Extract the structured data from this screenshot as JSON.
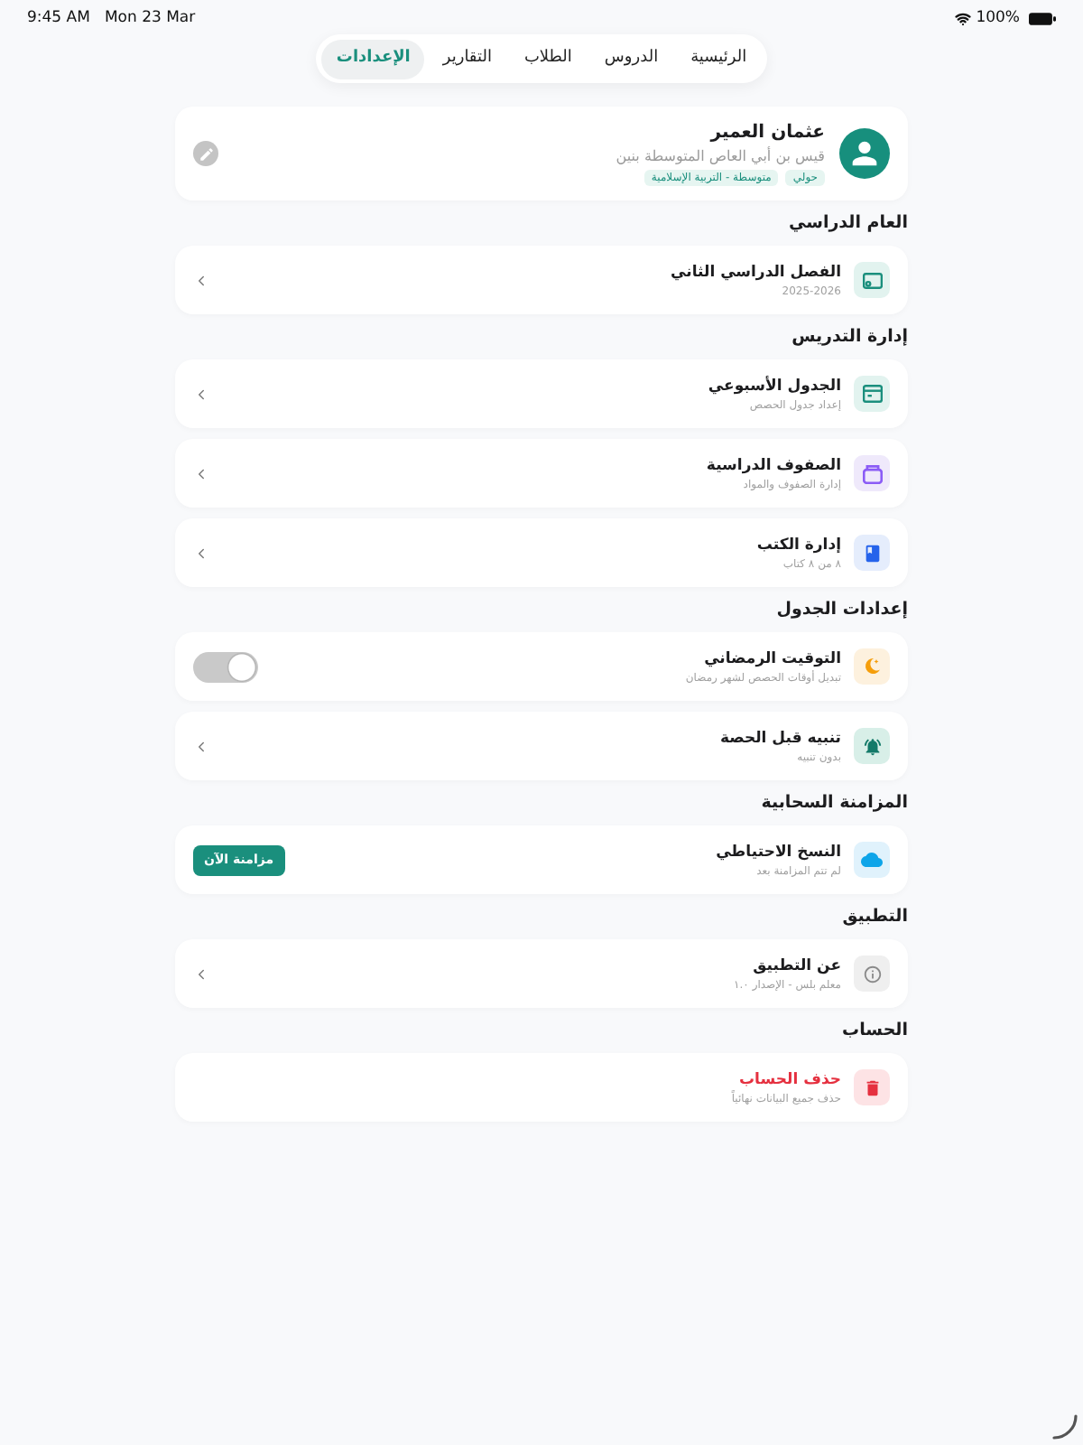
{
  "status_bar": {
    "time": "9:45 AM",
    "date": "Mon 23 Mar",
    "battery": "100%"
  },
  "tabs": [
    {
      "label": "الرئيسية",
      "selected": false
    },
    {
      "label": "الدروس",
      "selected": false
    },
    {
      "label": "الطلاب",
      "selected": false
    },
    {
      "label": "التقارير",
      "selected": false
    },
    {
      "label": "الإعدادات",
      "selected": true
    }
  ],
  "profile": {
    "name": "عثمان العمير",
    "school": "قيس بن أبي العاص المتوسطة بنين",
    "tags": [
      "حولي",
      "متوسطة - التربية الإسلامية"
    ]
  },
  "sections": [
    {
      "title": "العام الدراسي",
      "items": [
        {
          "kind": "link",
          "title": "الفصل الدراسي الثاني",
          "subtitle": "2025-2026"
        }
      ]
    },
    {
      "title": "إدارة التدريس",
      "items": [
        {
          "kind": "link",
          "title": "الجدول الأسبوعي",
          "subtitle": "إعداد جدول الحصص"
        },
        {
          "kind": "link",
          "title": "الصفوف الدراسية",
          "subtitle": "إدارة الصفوف والمواد"
        },
        {
          "kind": "link",
          "title": "إدارة الكتب",
          "subtitle": "٨ من ٨ كتاب"
        }
      ]
    },
    {
      "title": "إعدادات الجدول",
      "items": [
        {
          "kind": "toggle",
          "title": "التوقيت الرمضاني",
          "subtitle": "تبديل أوقات الحصص لشهر رمضان",
          "on": false
        },
        {
          "kind": "link",
          "title": "تنبيه قبل الحصة",
          "subtitle": "بدون تنبيه"
        }
      ]
    },
    {
      "title": "المزامنة السحابية",
      "items": [
        {
          "kind": "button",
          "title": "النسخ الاحتياطي",
          "subtitle": "لم تتم المزامنة بعد",
          "button": "مزامنة الآن"
        }
      ]
    },
    {
      "title": "التطبيق",
      "items": [
        {
          "kind": "link",
          "title": "عن التطبيق",
          "subtitle": "معلم بلس - الإصدار ١.٠"
        }
      ]
    },
    {
      "title": "الحساب",
      "items": [
        {
          "kind": "danger",
          "title": "حذف الحساب",
          "subtitle": "حذف جميع البيانات نهائياً"
        }
      ]
    }
  ]
}
